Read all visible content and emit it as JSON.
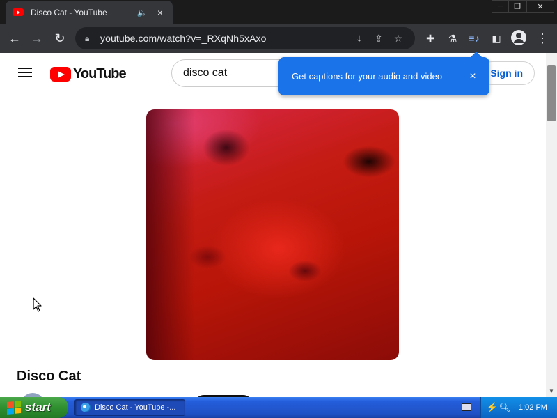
{
  "browser": {
    "tab": {
      "title": "Disco Cat - YouTube",
      "favicon": "youtube-icon",
      "audio_icon": "speaker-icon",
      "close_label": "×"
    },
    "window_controls": {
      "minimize": "─",
      "maximize": "❐",
      "close": "✕"
    },
    "nav": {
      "back": "←",
      "forward": "→",
      "reload": "↻"
    },
    "url": "youtube.com/watch?v=_RXqNh5xAxo",
    "omnibox_icons": [
      "install-icon",
      "share-icon",
      "bookmark-star-icon"
    ],
    "toolbar_icons": [
      "extensions-icon",
      "labs-flask-icon",
      "reading-list-icon",
      "side-panel-icon",
      "profile-icon",
      "kebab-menu-icon"
    ],
    "menu_glyph": "⋮"
  },
  "youtube": {
    "logo_text": "YouTube",
    "search_value": "disco cat",
    "signin_label": "Sign in",
    "video_title": "Disco Cat"
  },
  "caption_bubble": {
    "text": "Get captions for your audio and video",
    "close_label": "×"
  },
  "taskbar": {
    "start_label": "start",
    "task_label": "Disco Cat - YouTube -...",
    "clock": "1:02 PM"
  },
  "colors": {
    "chrome_dark": "#35363a",
    "bubble_blue": "#1a73e8",
    "youtube_red": "#ff0000",
    "signin_blue": "#065fd4",
    "xp_blue": "#245edb",
    "xp_green": "#2f8f2f"
  }
}
